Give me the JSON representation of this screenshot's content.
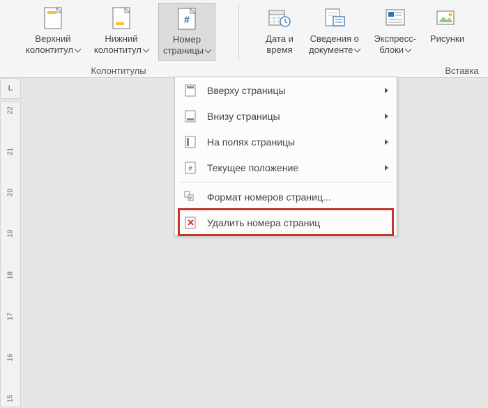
{
  "ribbon": {
    "group1": {
      "label": "Колонтитулы",
      "top_header": {
        "line1": "Верхний",
        "line2": "колонтитул"
      },
      "bottom_header": {
        "line1": "Нижний",
        "line2": "колонтитул"
      },
      "page_number": {
        "line1": "Номер",
        "line2": "страницы"
      }
    },
    "group2": {
      "label": "Вставка",
      "date_time": {
        "line1": "Дата и",
        "line2": "время"
      },
      "doc_info": {
        "line1": "Сведения о",
        "line2": "документе"
      },
      "quick_parts": {
        "line1": "Экспресс-",
        "line2": "блоки"
      },
      "images": {
        "line1": "Рисунки",
        "line2": ""
      }
    }
  },
  "menu": {
    "top": "Вверху страницы",
    "bottom": "Внизу страницы",
    "margins": "На полях страницы",
    "current": "Текущее положение",
    "format": "Формат номеров страниц...",
    "delete": "Удалить номера страниц"
  },
  "ruler_corner": "L",
  "ruler_ticks": [
    "22",
    "21",
    "20",
    "19",
    "18",
    "17",
    "16",
    "15"
  ]
}
